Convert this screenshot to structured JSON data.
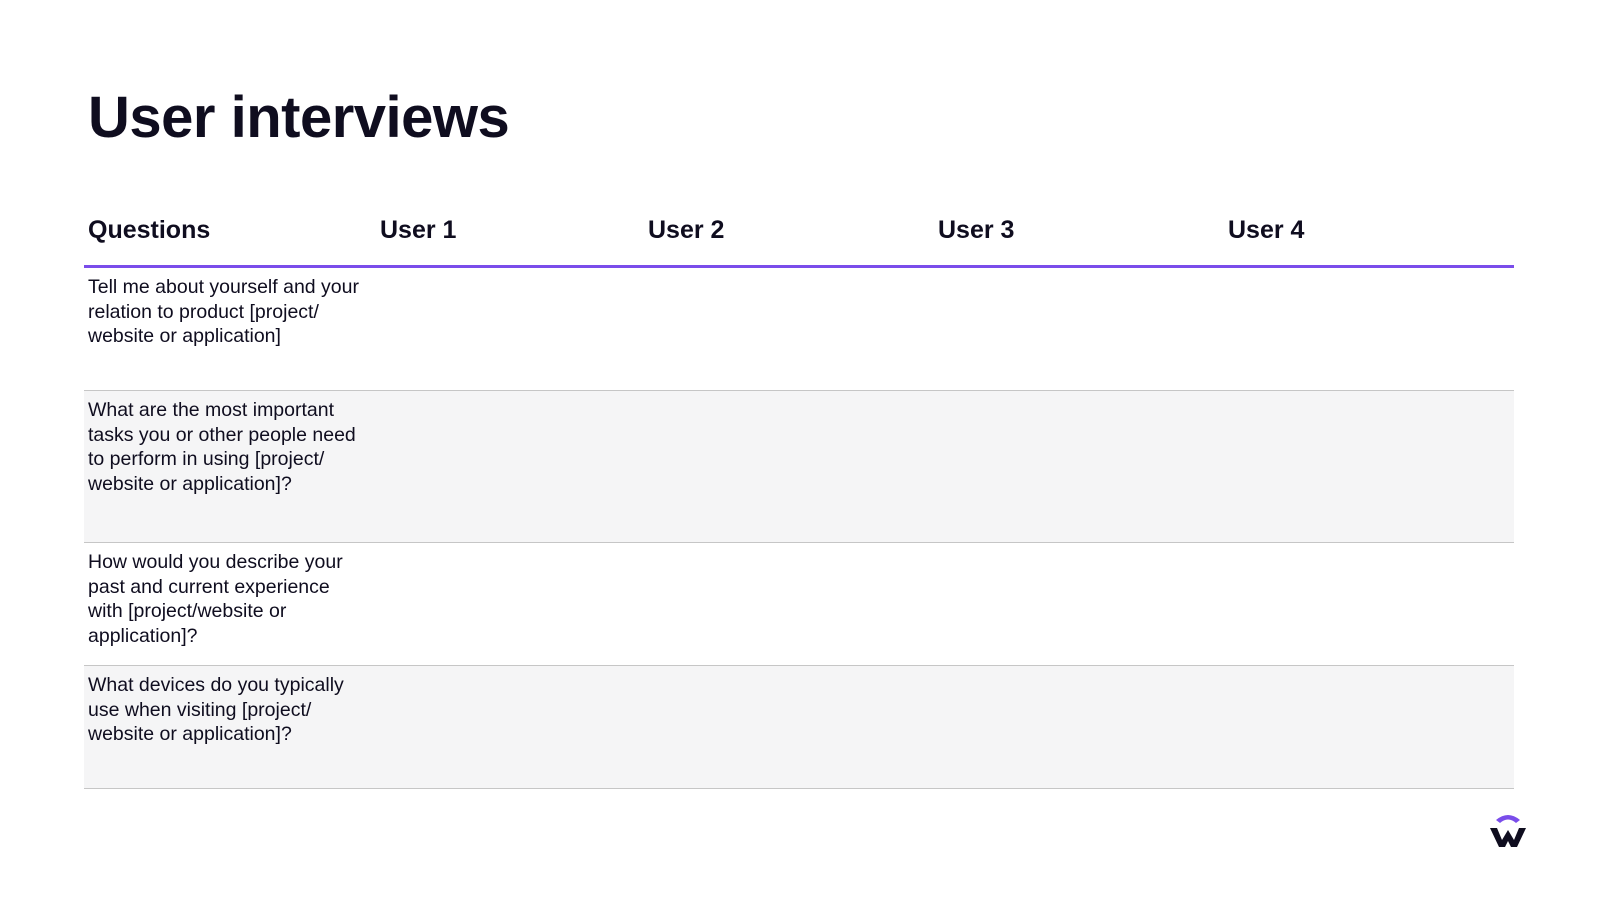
{
  "slide": {
    "title": "User interviews"
  },
  "table": {
    "headers": [
      "Questions",
      "User 1",
      "User 2",
      "User 3",
      "User 4"
    ],
    "rows": [
      {
        "question": "Tell me about yourself and your\nrelation to product [project/\nwebsite or application]"
      },
      {
        "question": "What are the most important\ntasks you or other people need\nto perform in using [project/\nwebsite or application]?"
      },
      {
        "question": "How would you describe your\npast and current experience\nwith [project/website or\napplication]?"
      },
      {
        "question": "What devices do you typically\nuse when visiting [project/\nwebsite or application]?"
      }
    ]
  },
  "colors": {
    "accent": "#7a4dea",
    "text": "#0f0d1f",
    "row_alt": "#f5f5f6",
    "divider": "#c6c6c6"
  },
  "icons": {
    "logo": "brand-logo-icon"
  }
}
